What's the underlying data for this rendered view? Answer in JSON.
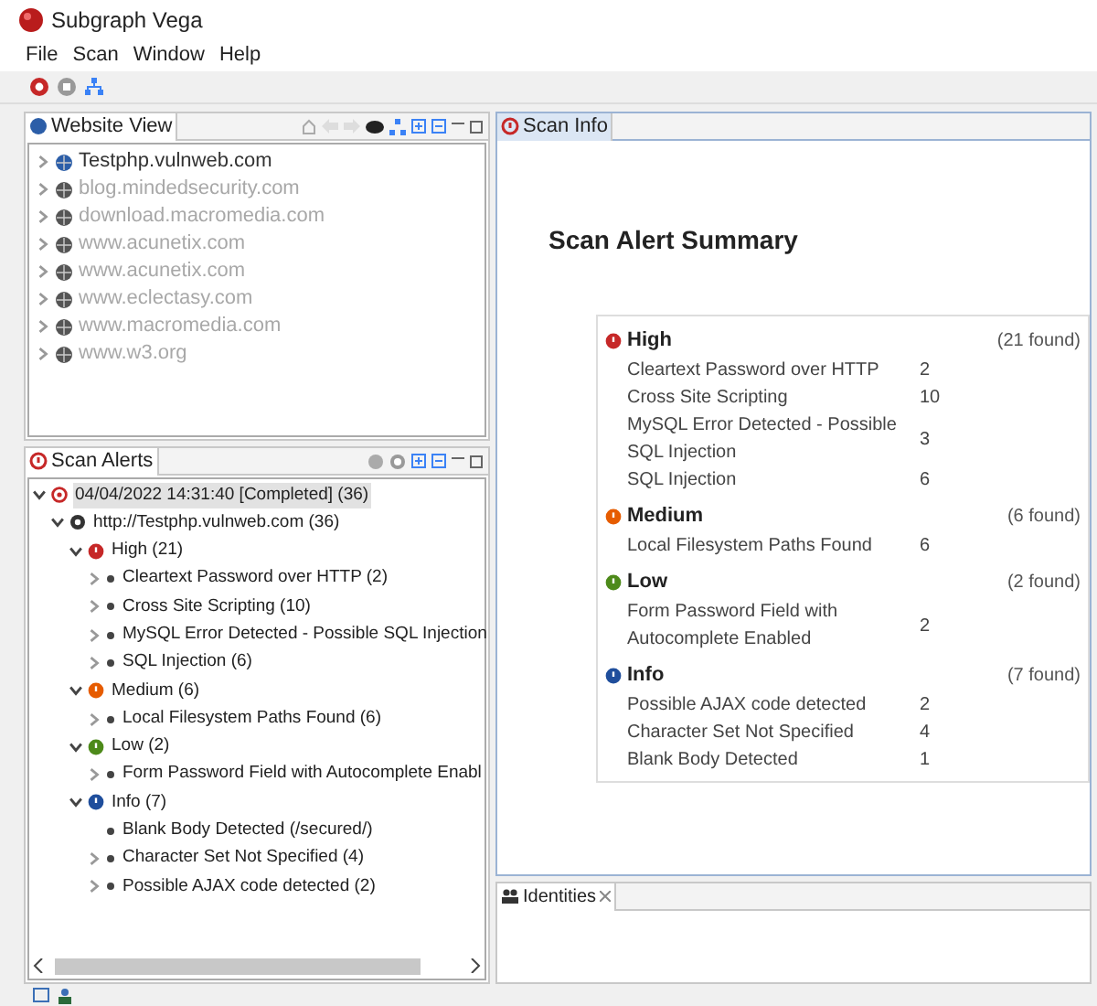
{
  "window": {
    "title": "Subgraph Vega"
  },
  "menu": [
    "File",
    "Scan",
    "Window",
    "Help"
  ],
  "website_view": {
    "title": "Website View",
    "items": [
      {
        "label": "Testphp.vulnweb.com",
        "disabled": false
      },
      {
        "label": "blog.mindedsecurity.com",
        "disabled": true
      },
      {
        "label": "download.macromedia.com",
        "disabled": true
      },
      {
        "label": "www.acunetix.com",
        "disabled": true
      },
      {
        "label": "www.acunetix.com",
        "disabled": true
      },
      {
        "label": "www.eclectasy.com",
        "disabled": true
      },
      {
        "label": "www.macromedia.com",
        "disabled": true
      },
      {
        "label": "www.w3.org",
        "disabled": true
      }
    ]
  },
  "scan_alerts": {
    "title": "Scan Alerts",
    "tree": [
      {
        "kind": "scan",
        "label": "04/04/2022 14:31:40 [Completed]  (36)",
        "selected": true,
        "expanded": true,
        "leaf": false,
        "children": [
          {
            "kind": "host",
            "label": "http://Testphp.vulnweb.com (36)",
            "selected": false,
            "expanded": true,
            "leaf": false,
            "children": [
              {
                "kind": "high",
                "label": "High (21)",
                "selected": false,
                "expanded": true,
                "leaf": false,
                "children": [
                  {
                    "kind": "alert",
                    "label": "Cleartext Password over HTTP (2)",
                    "selected": false,
                    "leaf": false
                  },
                  {
                    "kind": "alert",
                    "label": "Cross Site Scripting (10)",
                    "selected": false,
                    "leaf": false
                  },
                  {
                    "kind": "alert",
                    "label": "MySQL Error Detected - Possible SQL Injection",
                    "selected": false,
                    "leaf": false
                  },
                  {
                    "kind": "alert",
                    "label": "SQL Injection (6)",
                    "selected": false,
                    "leaf": false
                  }
                ]
              },
              {
                "kind": "medium",
                "label": "Medium (6)",
                "selected": false,
                "expanded": true,
                "leaf": false,
                "children": [
                  {
                    "kind": "alert",
                    "label": "Local Filesystem Paths Found (6)",
                    "selected": false,
                    "leaf": false
                  }
                ]
              },
              {
                "kind": "low",
                "label": "Low (2)",
                "selected": false,
                "expanded": true,
                "leaf": false,
                "children": [
                  {
                    "kind": "alert",
                    "label": "Form Password Field with Autocomplete Enabl",
                    "selected": false,
                    "leaf": false
                  }
                ]
              },
              {
                "kind": "info",
                "label": "Info (7)",
                "selected": false,
                "expanded": true,
                "leaf": false,
                "children": [
                  {
                    "kind": "alert",
                    "label": "Blank Body Detected (/secured/)",
                    "selected": false,
                    "leaf": true
                  },
                  {
                    "kind": "alert",
                    "label": "Character Set Not Specified  (4)",
                    "selected": false,
                    "leaf": false
                  },
                  {
                    "kind": "alert",
                    "label": "Possible AJAX code detected (2)",
                    "selected": false,
                    "leaf": false
                  }
                ]
              }
            ]
          }
        ]
      }
    ]
  },
  "scan_info": {
    "title": "Scan Info",
    "heading": "Scan Alert Summary",
    "groups": [
      {
        "kind": "high",
        "title": "High",
        "found": "(21 found)",
        "items": [
          {
            "name": "Cleartext Password over HTTP",
            "count": "2"
          },
          {
            "name": "Cross Site Scripting",
            "count": "10"
          },
          {
            "name": "MySQL Error Detected - Possible SQL Injection",
            "count": "3"
          },
          {
            "name": "SQL Injection",
            "count": "6"
          }
        ]
      },
      {
        "kind": "medium",
        "title": "Medium",
        "found": "(6 found)",
        "items": [
          {
            "name": "Local Filesystem Paths Found",
            "count": "6"
          }
        ]
      },
      {
        "kind": "low",
        "title": "Low",
        "found": "(2 found)",
        "items": [
          {
            "name": "Form Password Field with Autocomplete Enabled",
            "count": "2"
          }
        ]
      },
      {
        "kind": "info",
        "title": "Info",
        "found": "(7 found)",
        "items": [
          {
            "name": "Possible AJAX code detected",
            "count": "2"
          },
          {
            "name": "Character Set Not Specified",
            "count": "4"
          },
          {
            "name": "Blank Body Detected",
            "count": "1"
          }
        ]
      }
    ]
  },
  "identities": {
    "title": "Identities"
  }
}
